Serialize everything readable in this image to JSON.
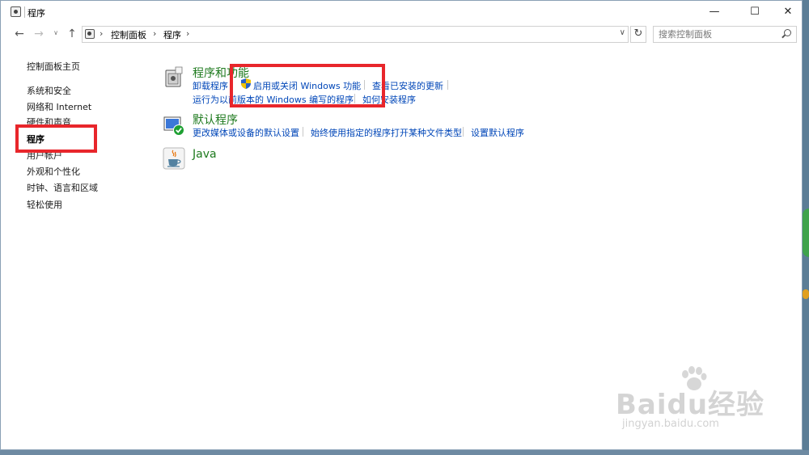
{
  "window": {
    "title": "程序",
    "controls": {
      "minimize": "—",
      "maximize": "☐",
      "close": "✕"
    }
  },
  "navbar": {
    "back": "←",
    "forward": "→",
    "recent": "∨",
    "up": "↑",
    "breadcrumb": [
      "控制面板",
      "程序"
    ],
    "chevron": "›",
    "dropdown": "∨",
    "refresh": "↻",
    "search_placeholder": "搜索控制面板"
  },
  "sidebar": {
    "items": [
      {
        "label": "控制面板主页"
      },
      {
        "label": "系统和安全"
      },
      {
        "label": "网络和 Internet"
      },
      {
        "label": "硬件和声音"
      },
      {
        "label": "程序",
        "active": true
      },
      {
        "label": "用户帐户"
      },
      {
        "label": "外观和个性化"
      },
      {
        "label": "时钟、语言和区域"
      },
      {
        "label": "轻松使用"
      }
    ]
  },
  "categories": [
    {
      "title": "程序和功能",
      "icon": "programs-features-icon",
      "links": [
        "卸载程序",
        "启用或关闭 Windows 功能",
        "查看已安装的更新",
        "运行为以前版本的 Windows 编写的程序",
        "如何安装程序"
      ]
    },
    {
      "title": "默认程序",
      "icon": "default-programs-icon",
      "links": [
        "更改媒体或设备的默认设置",
        "始终使用指定的程序打开某种文件类型",
        "设置默认程序"
      ]
    },
    {
      "title": "Java",
      "icon": "java-icon",
      "links": []
    }
  ],
  "watermark": {
    "brand": "Baidu经验",
    "url": "jingyan.baidu.com"
  },
  "colors": {
    "category_title": "#1e7a1e",
    "link": "#0046b8",
    "highlight": "#e8262b"
  }
}
